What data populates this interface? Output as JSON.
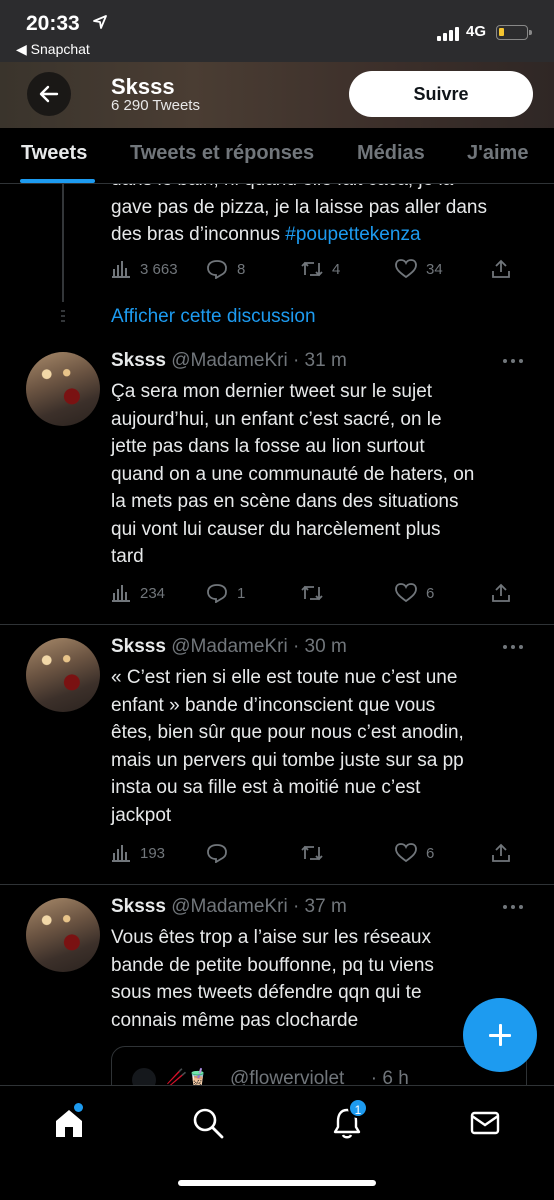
{
  "status_bar": {
    "time": "20:33",
    "back_app": "◀ Snapchat",
    "network": "4G"
  },
  "profile_header": {
    "name": "Sksss",
    "tweet_count": "6 290 Tweets",
    "follow_label": "Suivre"
  },
  "tabs": [
    {
      "label": "Tweets",
      "active": true
    },
    {
      "label": "Tweets et réponses",
      "active": false
    },
    {
      "label": "Médias",
      "active": false
    },
    {
      "label": "J'aime",
      "active": false
    }
  ],
  "tweets": [
    {
      "partial_text_1": "dans le bain, ni quand elle fait caca, je la",
      "partial_text_2": "gave pas de pizza, je la laisse pas aller dans",
      "partial_text_3": "des bras d’inconnus ",
      "hashtag": "#poupettekenza",
      "views": "3 663",
      "replies": "8",
      "retweets": "4",
      "likes": "34",
      "show_thread": "Afficher cette discussion"
    },
    {
      "name": "Sksss",
      "handle": "@MadameKri · 31 m",
      "lines": [
        "Ça sera mon dernier tweet sur le sujet",
        "aujourd’hui, un enfant c’est sacré, on le",
        "jette pas dans la fosse au lion surtout",
        "quand on a une communauté de haters, on",
        "la mets pas en scène dans des situations",
        "qui vont lui causer du harcèlement plus",
        "tard"
      ],
      "views": "234",
      "replies": "1",
      "retweets": "",
      "likes": "6"
    },
    {
      "name": "Sksss",
      "handle": "@MadameKri · 30 m",
      "lines": [
        "« C’est rien si elle est toute nue c’est une",
        "enfant » bande d’inconscient que vous",
        "êtes, bien sûr que pour nous c’est anodin,",
        "mais un pervers qui tombe juste sur sa pp",
        "insta ou sa fille est à moitié nue c’est",
        "jackpot"
      ],
      "views": "193",
      "replies": "",
      "retweets": "",
      "likes": "6"
    },
    {
      "name": "Sksss",
      "handle": "@MadameKri · 37 m",
      "lines": [
        "Vous êtes trop a l’aise sur les réseaux",
        "bande de petite bouffonne, pq tu viens",
        "sous mes tweets défendre qqn qui te",
        "connais même pas clocharde"
      ],
      "quote_handle": "@flowerviolet__ · 6 h",
      "quote_emoji": "🥢🧋"
    }
  ],
  "bottom_nav": {
    "notifications_badge": "1"
  },
  "colors": {
    "accent": "#1d9bf0",
    "muted": "#71767b",
    "background": "#000000"
  }
}
